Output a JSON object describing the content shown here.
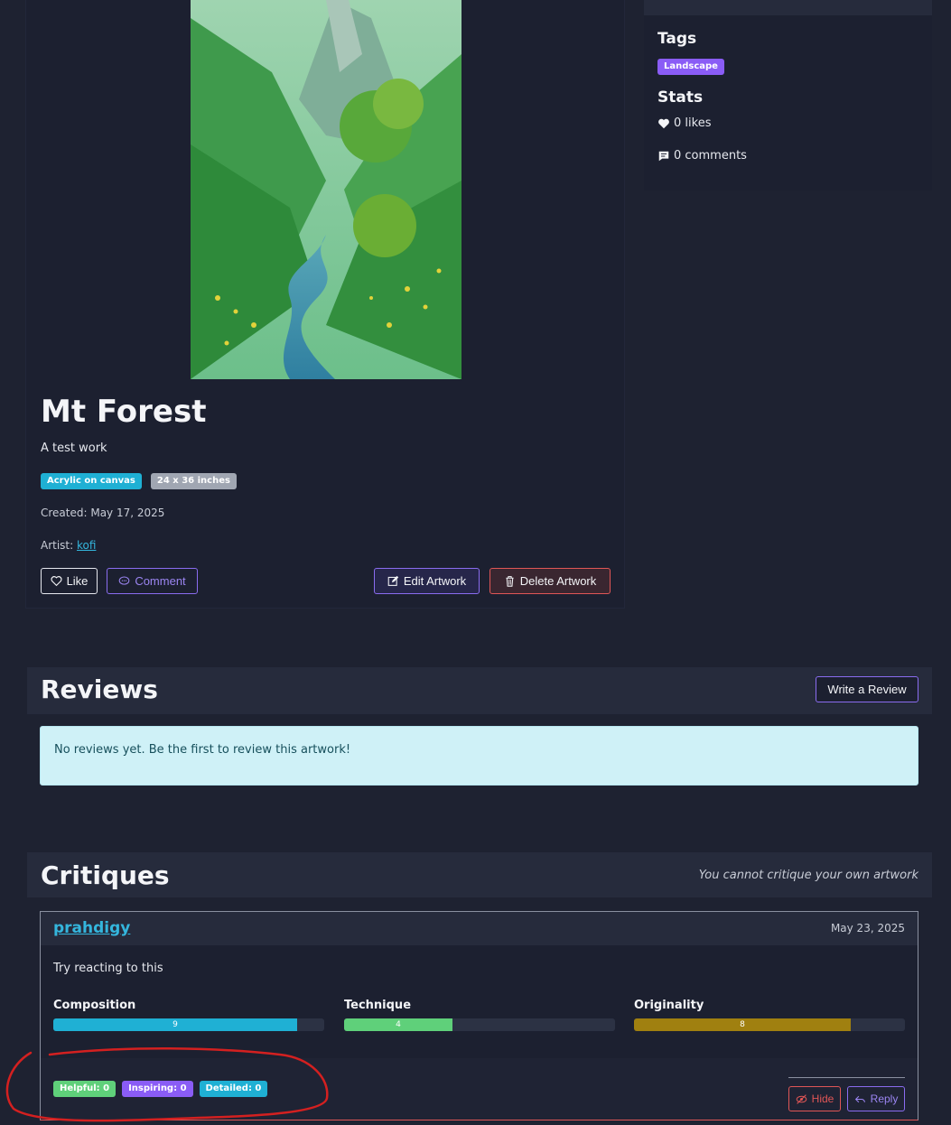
{
  "artwork": {
    "title": "Mt Forest",
    "description": "A test work",
    "medium": "Acrylic on canvas",
    "size": "24 x 36 inches",
    "created": "Created: May 17, 2025",
    "artist_label": "Artist:",
    "artist": "kofi",
    "like_label": "Like",
    "comment_label": "Comment",
    "edit_label": "Edit Artwork",
    "delete_label": "Delete Artwork"
  },
  "sidebar": {
    "tags_heading": "Tags",
    "tags": [
      "Landscape"
    ],
    "stats_heading": "Stats",
    "likes": "0 likes",
    "comments": "0 comments"
  },
  "reviews": {
    "heading": "Reviews",
    "write_label": "Write a Review",
    "empty_message": "No reviews yet. Be the first to review this artwork!"
  },
  "critiques": {
    "heading": "Critiques",
    "note": "You cannot critique your own artwork",
    "items": [
      {
        "user": "prahdigy",
        "date": "May 23, 2025",
        "text": "Try reacting to this",
        "scores": [
          {
            "label": "Composition",
            "value": 9,
            "max": 10,
            "color": "#1fb0d4"
          },
          {
            "label": "Technique",
            "value": 4,
            "max": 10,
            "color": "#5fd07a"
          },
          {
            "label": "Originality",
            "value": 8,
            "max": 10,
            "color": "#a08010"
          }
        ],
        "reactions": {
          "helpful": "Helpful: 0",
          "inspiring": "Inspiring: 0",
          "detailed": "Detailed: 0"
        },
        "hide_label": "Hide",
        "reply_label": "Reply"
      }
    ]
  },
  "colors": {
    "background": "#1e2231",
    "accent_purple": "#8a6cf0",
    "danger": "#e05656",
    "info": "#1fb0d4",
    "annotation": "#d42020"
  }
}
